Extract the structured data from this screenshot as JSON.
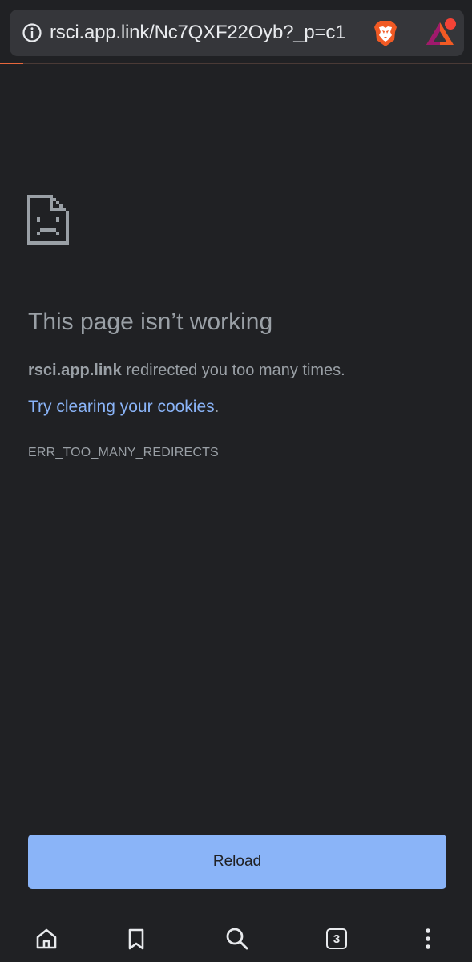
{
  "address_bar": {
    "url": "rsci.app.link/Nc7QXF22Oyb?_p=c1",
    "info_icon": "info-icon",
    "shields_icon": "brave-lion-icon",
    "rewards_icon": "brave-rewards-triangle-icon",
    "load_progress": 0.05
  },
  "error_page": {
    "icon": "sad-page-icon",
    "heading": "This page isn’t working",
    "host": "rsci.app.link",
    "message_rest": " redirected you too many times.",
    "suggestion_link": "Try clearing your cookies",
    "suggestion_end": ".",
    "error_code": "ERR_TOO_MANY_REDIRECTS",
    "reload_label": "Reload"
  },
  "toolbar": {
    "home_icon": "home-icon",
    "bookmark_icon": "bookmark-icon",
    "search_icon": "search-icon",
    "tab_count": "3",
    "menu_icon": "more-vertical-icon"
  },
  "colors": {
    "background": "#202124",
    "text": "#9aa0a6",
    "link": "#8ab4f8",
    "button": "#8ab4f8",
    "progress": "#e8673c",
    "url_box": "#35363a"
  }
}
